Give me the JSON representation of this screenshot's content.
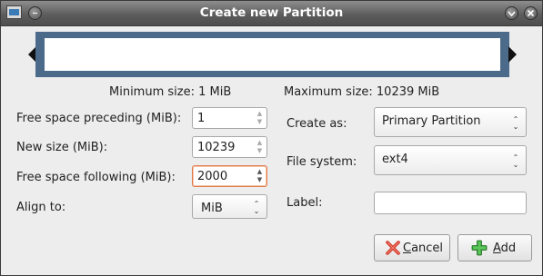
{
  "window": {
    "title": "Create new Partition"
  },
  "sizes": {
    "minimum": "Minimum size: 1 MiB",
    "maximum": "Maximum size: 10239 MiB"
  },
  "left": {
    "preceding_label": "Free space preceding (MiB):",
    "preceding_value": "1",
    "newsize_label": "New size (MiB):",
    "newsize_value": "10239",
    "following_label": "Free space following (MiB):",
    "following_value": "2000",
    "align_label": "Align to:",
    "align_value": "MiB"
  },
  "right": {
    "create_as_label": "Create as:",
    "create_as_value": "Primary Partition",
    "filesystem_label": "File system:",
    "filesystem_value": "ext4",
    "label_label": "Label:",
    "label_value": ""
  },
  "buttons": {
    "cancel_mnemonic": "C",
    "cancel_rest": "ancel",
    "add_mnemonic": "A",
    "add_rest": "dd"
  },
  "colors": {
    "partition_frame": "#4c6b8a",
    "cancel_icon": "#d23b2b",
    "add_icon": "#3aa53a",
    "focus_border": "#e07b4b"
  }
}
